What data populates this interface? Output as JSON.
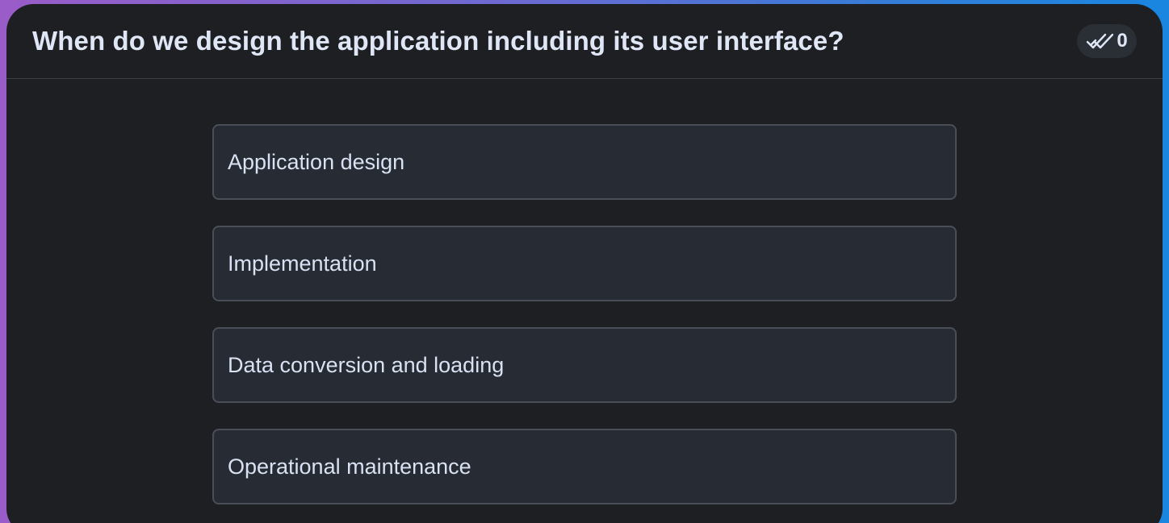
{
  "question": {
    "text": "When do we design the application including its user interface?"
  },
  "badge": {
    "icon": "double-check-icon",
    "count": "0"
  },
  "options": [
    {
      "label": "Application design"
    },
    {
      "label": "Implementation"
    },
    {
      "label": "Data conversion and loading"
    },
    {
      "label": "Operational maintenance"
    }
  ],
  "colors": {
    "card_background": "#1e1f22",
    "option_background": "#272b33",
    "option_border": "#4a4f57",
    "text": "#dfe6f5"
  }
}
